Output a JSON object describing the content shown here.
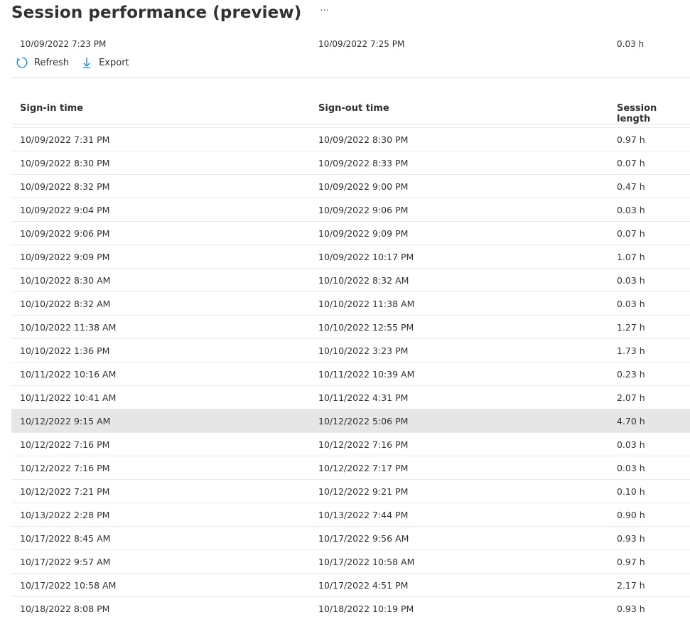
{
  "header": {
    "title": "Session performance (preview)",
    "more_label": "···"
  },
  "ghost_row": {
    "sign_in": "10/09/2022 7:23 PM",
    "sign_out": "10/09/2022 7:25 PM",
    "length": "0.03 h"
  },
  "toolbar": {
    "refresh_label": "Refresh",
    "export_label": "Export",
    "refresh_icon": "refresh-icon",
    "export_icon": "download-icon"
  },
  "colors": {
    "accent": "#0078d4",
    "selected_row": "#e6e6e6",
    "divider": "#edebe9"
  },
  "table": {
    "columns": [
      "Sign-in time",
      "Sign-out time",
      "Session length"
    ],
    "selected_index": 12,
    "rows": [
      [
        "10/09/2022 7:31 PM",
        "10/09/2022 8:30 PM",
        "0.97 h"
      ],
      [
        "10/09/2022 8:30 PM",
        "10/09/2022 8:33 PM",
        "0.07 h"
      ],
      [
        "10/09/2022 8:32 PM",
        "10/09/2022 9:00 PM",
        "0.47 h"
      ],
      [
        "10/09/2022 9:04 PM",
        "10/09/2022 9:06 PM",
        "0.03 h"
      ],
      [
        "10/09/2022 9:06 PM",
        "10/09/2022 9:09 PM",
        "0.07 h"
      ],
      [
        "10/09/2022 9:09 PM",
        "10/09/2022 10:17 PM",
        "1.07 h"
      ],
      [
        "10/10/2022 8:30 AM",
        "10/10/2022 8:32 AM",
        "0.03 h"
      ],
      [
        "10/10/2022 8:32 AM",
        "10/10/2022 11:38 AM",
        "0.03 h"
      ],
      [
        "10/10/2022 11:38 AM",
        "10/10/2022 12:55 PM",
        "1.27 h"
      ],
      [
        "10/10/2022 1:36 PM",
        "10/10/2022 3:23 PM",
        "1.73 h"
      ],
      [
        "10/11/2022 10:16 AM",
        "10/11/2022 10:39 AM",
        "0.23 h"
      ],
      [
        "10/11/2022 10:41 AM",
        "10/11/2022 4:31 PM",
        "2.07 h"
      ],
      [
        "10/12/2022 9:15 AM",
        "10/12/2022 5:06 PM",
        "4.70 h"
      ],
      [
        "10/12/2022 7:16 PM",
        "10/12/2022 7:16 PM",
        "0.03 h"
      ],
      [
        "10/12/2022 7:16 PM",
        "10/12/2022 7:17 PM",
        "0.03 h"
      ],
      [
        "10/12/2022 7:21 PM",
        "10/12/2022 9:21 PM",
        "0.10 h"
      ],
      [
        "10/13/2022 2:28 PM",
        "10/13/2022 7:44 PM",
        "0.90 h"
      ],
      [
        "10/17/2022 8:45 AM",
        "10/17/2022 9:56 AM",
        "0.93 h"
      ],
      [
        "10/17/2022 9:57 AM",
        "10/17/2022 10:58 AM",
        "0.97 h"
      ],
      [
        "10/17/2022 10:58 AM",
        "10/17/2022 4:51 PM",
        "2.17 h"
      ],
      [
        "10/18/2022 8:08 PM",
        "10/18/2022 10:19 PM",
        "0.93 h"
      ]
    ]
  }
}
